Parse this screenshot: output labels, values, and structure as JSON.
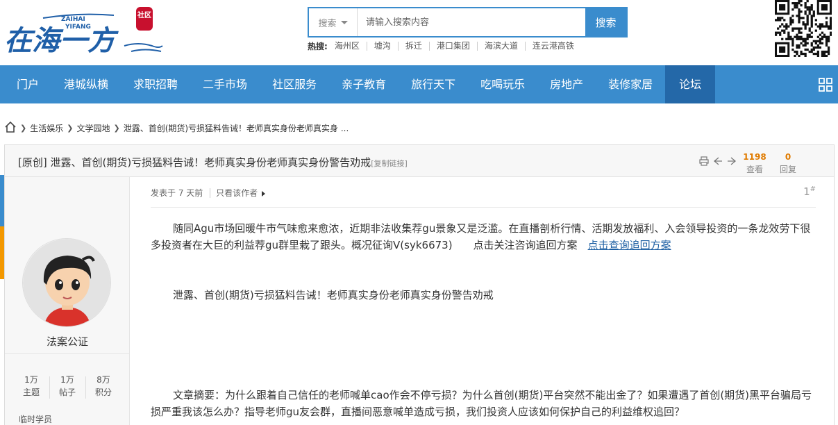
{
  "header": {
    "logo": {
      "main_text": "在海一方",
      "pinyin_top": "ZAIHAI",
      "pinyin_bottom": "YIFANG",
      "seal_text": "社区"
    },
    "search": {
      "type_label": "搜索",
      "placeholder": "请输入搜索内容",
      "button_label": "搜索"
    },
    "hot": {
      "label": "热搜:",
      "items": [
        "海州区",
        "墟沟",
        "拆迁",
        "港口集团",
        "海滨大道",
        "连云港高铁"
      ]
    }
  },
  "nav": {
    "items": [
      "门户",
      "港城纵横",
      "求职招聘",
      "二手市场",
      "社区服务",
      "亲子教育",
      "旅行天下",
      "吃喝玩乐",
      "房地产",
      "装修家居",
      "论坛"
    ]
  },
  "breadcrumb": {
    "items": [
      "生活娱乐",
      "文学园地",
      "泄露、首创(期货)亏损猛料告诫！老师真实身份老师真实身 ..."
    ]
  },
  "thread": {
    "title": "[原创] 泄露、首创(期货)亏损猛料告诫！老师真实身份老师真实身份警告劝戒",
    "copy_link": "[复制链接]",
    "views": "1198",
    "views_label": "查看",
    "replies": "0",
    "replies_label": "回复"
  },
  "author": {
    "name": "法案公证",
    "stats": [
      {
        "value": "1万",
        "label": "主题"
      },
      {
        "value": "1万",
        "label": "帖子"
      },
      {
        "value": "8万",
        "label": "积分"
      }
    ],
    "level": "临时学员"
  },
  "post": {
    "posted": "发表于 7 天前",
    "only_author": "只看该作者",
    "floor": "1",
    "floor_mark": "#",
    "p1": "随同Agu市场回暖牛市气味愈来愈浓，近期非法收集荐gu景象又是泛滥。在直播剖析行情、活期发放福利、入会领导投资的一条龙效劳下很多投资者在大巨的利益荐gu群里栽了跟头。概况征询V(syk6673)　　点击关注咨询追回方案　",
    "p1_link": "点击查询追回方案",
    "p2": "泄露、首创(期货)亏损猛料告诫！老师真实身份老师真实身份警告劝戒",
    "p3": "文章摘要：为什么跟着自己信任的老师喊单cao作会不停亏损？为什么首创(期货)平台突然不能出金了？如果遭遇了首创(期货)黑平台骗局亏损严重我该怎么办？指导老师gu友会群，直播间恶意喊单造成亏损，我们投资人应该如何保护自己的利益维权追回？"
  },
  "colors": {
    "primary": "#3a8ccd",
    "nav_active": "#2468a8",
    "accent_orange": "#f39800",
    "logo_blue": "#1f5fa8",
    "seal_red": "#c8102e"
  }
}
